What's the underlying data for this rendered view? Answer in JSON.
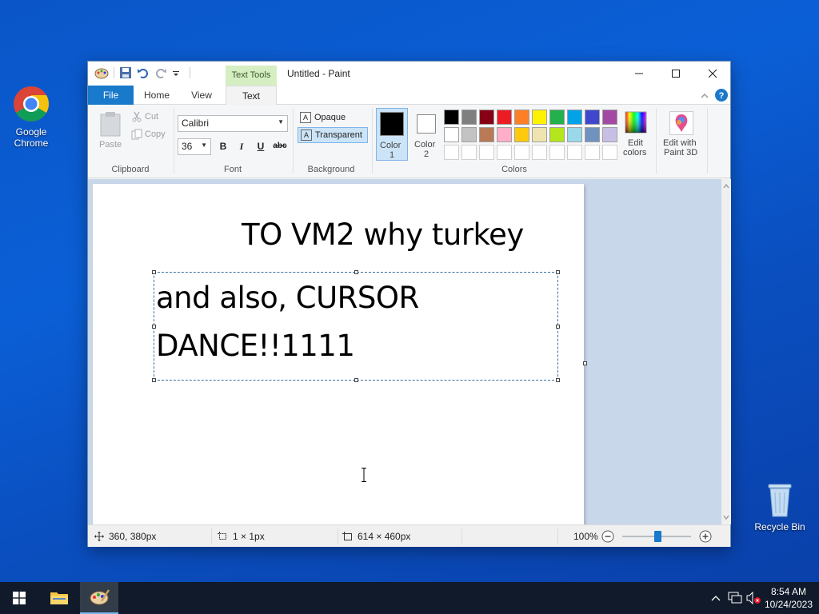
{
  "desktop": {
    "icons": [
      {
        "label_line1": "Google",
        "label_line2": "Chrome"
      },
      {
        "label": "Recycle Bin"
      }
    ]
  },
  "paint": {
    "context_tab": "Text Tools",
    "title": "Untitled - Paint",
    "tabs": [
      "File",
      "Home",
      "View",
      "Text"
    ],
    "active_tab": "Text",
    "clipboard": {
      "paste": "Paste",
      "cut": "Cut",
      "copy": "Copy",
      "label": "Clipboard"
    },
    "font": {
      "family": "Calibri",
      "size": "36",
      "label": "Font",
      "bold": "B",
      "italic": "I",
      "underline": "U",
      "strike": "abc"
    },
    "background": {
      "opaque": "Opaque",
      "transparent": "Transparent",
      "label": "Background"
    },
    "colors": {
      "color1_line1": "Color",
      "color1_line2": "1",
      "color2_line1": "Color",
      "color2_line2": "2",
      "label": "Colors",
      "edit_line1": "Edit",
      "edit_line2": "colors",
      "paint3d_line1": "Edit with",
      "paint3d_line2": "Paint 3D",
      "color1_value": "#000000",
      "color2_value": "#ffffff",
      "palette_row1": [
        "#000000",
        "#7f7f7f",
        "#880015",
        "#ed1c24",
        "#ff7f27",
        "#fff200",
        "#22b14c",
        "#00a2e8",
        "#3f48cc",
        "#a349a4"
      ],
      "palette_row2": [
        "#ffffff",
        "#c3c3c3",
        "#b97a57",
        "#ffaec9",
        "#ffc90e",
        "#efe4b0",
        "#b5e61d",
        "#99d9ea",
        "#7092be",
        "#c8bfe7"
      ]
    },
    "canvas": {
      "line1": "TO VM2 why turkey",
      "line2": "and also, CURSOR",
      "line3": "DANCE!!1111"
    },
    "status": {
      "cursor_pos": "360, 380px",
      "selection_size": "1 × 1px",
      "image_size": "614 × 460px",
      "zoom": "100%"
    }
  },
  "taskbar": {
    "time": "8:54 AM",
    "date": "10/24/2023"
  }
}
